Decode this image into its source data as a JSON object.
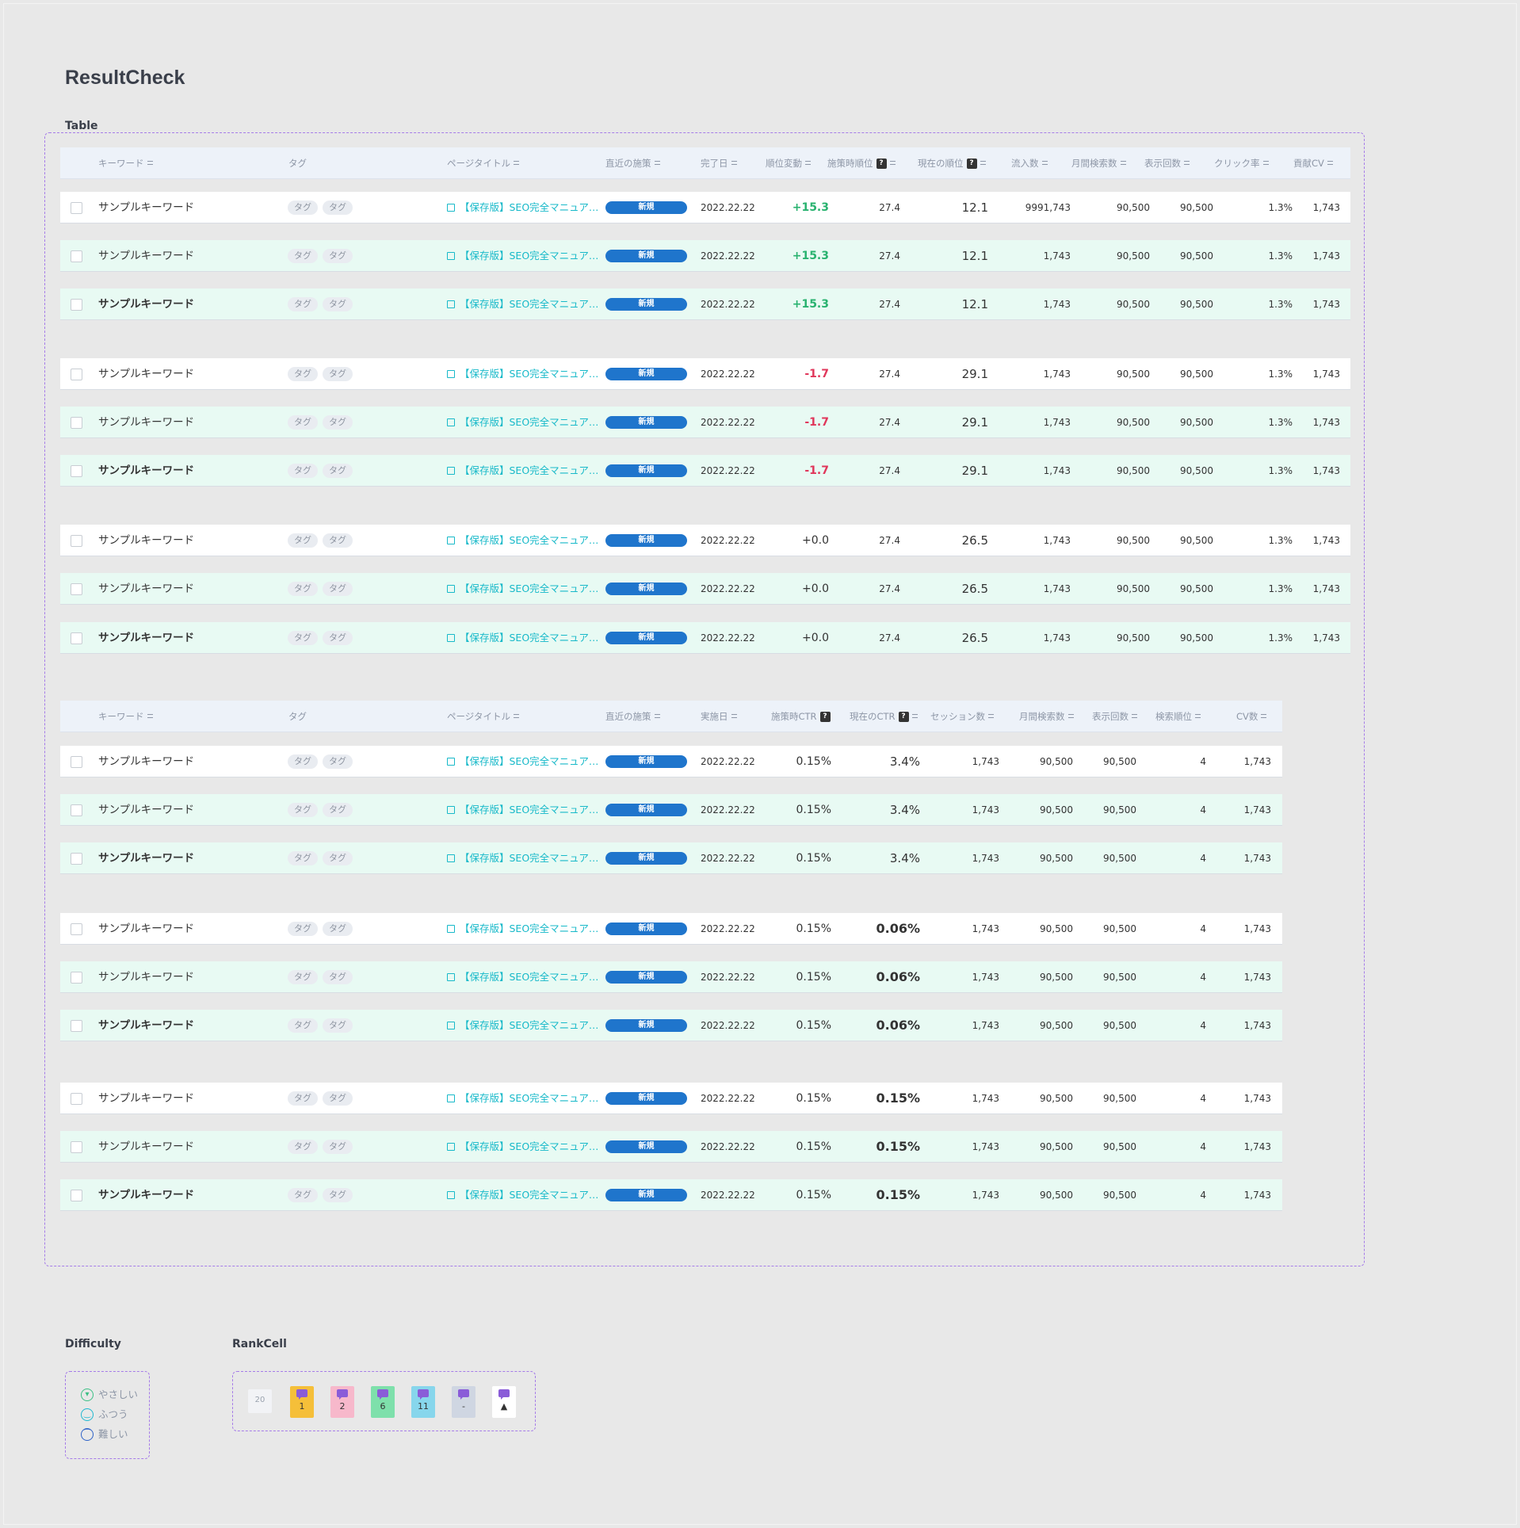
{
  "page": {
    "title": "ResultCheck"
  },
  "sections": {
    "table": "Table",
    "difficulty": "Difficulty",
    "rankcell": "RankCell"
  },
  "table1": {
    "headers": {
      "keyword": "キーワード",
      "tag": "タグ",
      "page_title": "ページタイトル",
      "recent": "直近の施策",
      "done_date": "完了日",
      "rank_change": "順位変動",
      "rank_at": "施策時順位",
      "rank_now": "現在の順位",
      "inflow": "流入数",
      "monthly": "月間検索数",
      "impressions": "表示回数",
      "ctr": "クリック率",
      "cv": "貢献CV"
    },
    "qmark": "?",
    "rows": [
      {
        "kw": "サンプルキーワード",
        "bold": false,
        "tags": [
          "タグ",
          "タグ"
        ],
        "title": "【保存版】SEO完全マニュア…",
        "badge": "新規",
        "date": "2022.22.22",
        "change": "+15.3",
        "dir": "pos",
        "rank_at": "27.4",
        "rank_now": "12.1",
        "inflow": "9991,743",
        "monthly": "90,500",
        "imp": "90,500",
        "ctr": "1.3%",
        "cv": "1,743",
        "mint": false
      },
      {
        "kw": "サンプルキーワード",
        "bold": false,
        "tags": [
          "タグ",
          "タグ"
        ],
        "title": "【保存版】SEO完全マニュア…",
        "badge": "新規",
        "date": "2022.22.22",
        "change": "+15.3",
        "dir": "pos",
        "rank_at": "27.4",
        "rank_now": "12.1",
        "inflow": "1,743",
        "monthly": "90,500",
        "imp": "90,500",
        "ctr": "1.3%",
        "cv": "1,743",
        "mint": true
      },
      {
        "kw": "サンプルキーワード",
        "bold": true,
        "tags": [
          "タグ",
          "タグ"
        ],
        "title": "【保存版】SEO完全マニュア…",
        "badge": "新規",
        "date": "2022.22.22",
        "change": "+15.3",
        "dir": "pos",
        "rank_at": "27.4",
        "rank_now": "12.1",
        "inflow": "1,743",
        "monthly": "90,500",
        "imp": "90,500",
        "ctr": "1.3%",
        "cv": "1,743",
        "mint": true
      },
      {
        "kw": "サンプルキーワード",
        "bold": false,
        "tags": [
          "タグ",
          "タグ"
        ],
        "title": "【保存版】SEO完全マニュア…",
        "badge": "新規",
        "date": "2022.22.22",
        "change": "-1.7",
        "dir": "neg",
        "rank_at": "27.4",
        "rank_now": "29.1",
        "inflow": "1,743",
        "monthly": "90,500",
        "imp": "90,500",
        "ctr": "1.3%",
        "cv": "1,743",
        "mint": false
      },
      {
        "kw": "サンプルキーワード",
        "bold": false,
        "tags": [
          "タグ",
          "タグ"
        ],
        "title": "【保存版】SEO完全マニュア…",
        "badge": "新規",
        "date": "2022.22.22",
        "change": "-1.7",
        "dir": "neg",
        "rank_at": "27.4",
        "rank_now": "29.1",
        "inflow": "1,743",
        "monthly": "90,500",
        "imp": "90,500",
        "ctr": "1.3%",
        "cv": "1,743",
        "mint": true
      },
      {
        "kw": "サンプルキーワード",
        "bold": true,
        "tags": [
          "タグ",
          "タグ"
        ],
        "title": "【保存版】SEO完全マニュア…",
        "badge": "新規",
        "date": "2022.22.22",
        "change": "-1.7",
        "dir": "neg",
        "rank_at": "27.4",
        "rank_now": "29.1",
        "inflow": "1,743",
        "monthly": "90,500",
        "imp": "90,500",
        "ctr": "1.3%",
        "cv": "1,743",
        "mint": true
      },
      {
        "kw": "サンプルキーワード",
        "bold": false,
        "tags": [
          "タグ",
          "タグ"
        ],
        "title": "【保存版】SEO完全マニュア…",
        "badge": "新規",
        "date": "2022.22.22",
        "change": "+0.0",
        "dir": "neu",
        "rank_at": "27.4",
        "rank_now": "26.5",
        "inflow": "1,743",
        "monthly": "90,500",
        "imp": "90,500",
        "ctr": "1.3%",
        "cv": "1,743",
        "mint": false
      },
      {
        "kw": "サンプルキーワード",
        "bold": false,
        "tags": [
          "タグ",
          "タグ"
        ],
        "title": "【保存版】SEO完全マニュア…",
        "badge": "新規",
        "date": "2022.22.22",
        "change": "+0.0",
        "dir": "neu",
        "rank_at": "27.4",
        "rank_now": "26.5",
        "inflow": "1,743",
        "monthly": "90,500",
        "imp": "90,500",
        "ctr": "1.3%",
        "cv": "1,743",
        "mint": true
      },
      {
        "kw": "サンプルキーワード",
        "bold": true,
        "tags": [
          "タグ",
          "タグ"
        ],
        "title": "【保存版】SEO完全マニュア…",
        "badge": "新規",
        "date": "2022.22.22",
        "change": "+0.0",
        "dir": "neu",
        "rank_at": "27.4",
        "rank_now": "26.5",
        "inflow": "1,743",
        "monthly": "90,500",
        "imp": "90,500",
        "ctr": "1.3%",
        "cv": "1,743",
        "mint": true
      }
    ]
  },
  "table2": {
    "headers": {
      "keyword": "キーワード",
      "tag": "タグ",
      "page_title": "ページタイトル",
      "recent": "直近の施策",
      "exec_date": "実施日",
      "ctr_at": "施策時CTR",
      "ctr_now": "現在のCTR",
      "sessions": "セッション数",
      "monthly": "月間検索数",
      "impressions": "表示回数",
      "search_rank": "検索順位",
      "cv": "CV数"
    },
    "qmark": "?",
    "rows": [
      {
        "kw": "サンプルキーワード",
        "bold": false,
        "tags": [
          "タグ",
          "タグ"
        ],
        "title": "【保存版】SEO完全マニュア…",
        "badge": "新規",
        "date": "2022.22.22",
        "ctr_at": "0.15%",
        "ctr_now": "3.4%",
        "now_bold": false,
        "sessions": "1,743",
        "monthly": "90,500",
        "imp": "90,500",
        "rank": "4",
        "cv": "1,743",
        "mint": false
      },
      {
        "kw": "サンプルキーワード",
        "bold": false,
        "tags": [
          "タグ",
          "タグ"
        ],
        "title": "【保存版】SEO完全マニュア…",
        "badge": "新規",
        "date": "2022.22.22",
        "ctr_at": "0.15%",
        "ctr_now": "3.4%",
        "now_bold": false,
        "sessions": "1,743",
        "monthly": "90,500",
        "imp": "90,500",
        "rank": "4",
        "cv": "1,743",
        "mint": true
      },
      {
        "kw": "サンプルキーワード",
        "bold": true,
        "tags": [
          "タグ",
          "タグ"
        ],
        "title": "【保存版】SEO完全マニュア…",
        "badge": "新規",
        "date": "2022.22.22",
        "ctr_at": "0.15%",
        "ctr_now": "3.4%",
        "now_bold": false,
        "sessions": "1,743",
        "monthly": "90,500",
        "imp": "90,500",
        "rank": "4",
        "cv": "1,743",
        "mint": true
      },
      {
        "kw": "サンプルキーワード",
        "bold": false,
        "tags": [
          "タグ",
          "タグ"
        ],
        "title": "【保存版】SEO完全マニュア…",
        "badge": "新規",
        "date": "2022.22.22",
        "ctr_at": "0.15%",
        "ctr_now": "0.06%",
        "now_bold": true,
        "sessions": "1,743",
        "monthly": "90,500",
        "imp": "90,500",
        "rank": "4",
        "cv": "1,743",
        "mint": false
      },
      {
        "kw": "サンプルキーワード",
        "bold": false,
        "tags": [
          "タグ",
          "タグ"
        ],
        "title": "【保存版】SEO完全マニュア…",
        "badge": "新規",
        "date": "2022.22.22",
        "ctr_at": "0.15%",
        "ctr_now": "0.06%",
        "now_bold": true,
        "sessions": "1,743",
        "monthly": "90,500",
        "imp": "90,500",
        "rank": "4",
        "cv": "1,743",
        "mint": true
      },
      {
        "kw": "サンプルキーワード",
        "bold": true,
        "tags": [
          "タグ",
          "タグ"
        ],
        "title": "【保存版】SEO完全マニュア…",
        "badge": "新規",
        "date": "2022.22.22",
        "ctr_at": "0.15%",
        "ctr_now": "0.06%",
        "now_bold": true,
        "sessions": "1,743",
        "monthly": "90,500",
        "imp": "90,500",
        "rank": "4",
        "cv": "1,743",
        "mint": true
      },
      {
        "kw": "サンプルキーワード",
        "bold": false,
        "tags": [
          "タグ",
          "タグ"
        ],
        "title": "【保存版】SEO完全マニュア…",
        "badge": "新規",
        "date": "2022.22.22",
        "ctr_at": "0.15%",
        "ctr_now": "0.15%",
        "now_bold": true,
        "sessions": "1,743",
        "monthly": "90,500",
        "imp": "90,500",
        "rank": "4",
        "cv": "1,743",
        "mint": false
      },
      {
        "kw": "サンプルキーワード",
        "bold": false,
        "tags": [
          "タグ",
          "タグ"
        ],
        "title": "【保存版】SEO完全マニュア…",
        "badge": "新規",
        "date": "2022.22.22",
        "ctr_at": "0.15%",
        "ctr_now": "0.15%",
        "now_bold": true,
        "sessions": "1,743",
        "monthly": "90,500",
        "imp": "90,500",
        "rank": "4",
        "cv": "1,743",
        "mint": true
      },
      {
        "kw": "サンプルキーワード",
        "bold": true,
        "tags": [
          "タグ",
          "タグ"
        ],
        "title": "【保存版】SEO完全マニュア…",
        "badge": "新規",
        "date": "2022.22.22",
        "ctr_at": "0.15%",
        "ctr_now": "0.15%",
        "now_bold": true,
        "sessions": "1,743",
        "monthly": "90,500",
        "imp": "90,500",
        "rank": "4",
        "cv": "1,743",
        "mint": true
      }
    ]
  },
  "difficulty": [
    {
      "label": "やさしい",
      "icon": "grin-face-icon",
      "color": "#3cbf85"
    },
    {
      "label": "ふつう",
      "icon": "smile-face-icon",
      "color": "#1fb8d0"
    },
    {
      "label": "難しい",
      "icon": "frown-face-icon",
      "color": "#2f63c8"
    }
  ],
  "rankcells": [
    {
      "value": "20",
      "bg": "#f2f3f6",
      "flag": false
    },
    {
      "value": "1",
      "bg": "#f5bf39",
      "flag": true
    },
    {
      "value": "2",
      "bg": "#f7b8cb",
      "flag": true
    },
    {
      "value": "6",
      "bg": "#7ee0ab",
      "flag": true
    },
    {
      "value": "11",
      "bg": "#87d6ec",
      "flag": true
    },
    {
      "value": "-",
      "bg": "#cfd6e2",
      "flag": true
    },
    {
      "value": "▲",
      "bg": "#ffffff",
      "flag": true
    }
  ]
}
